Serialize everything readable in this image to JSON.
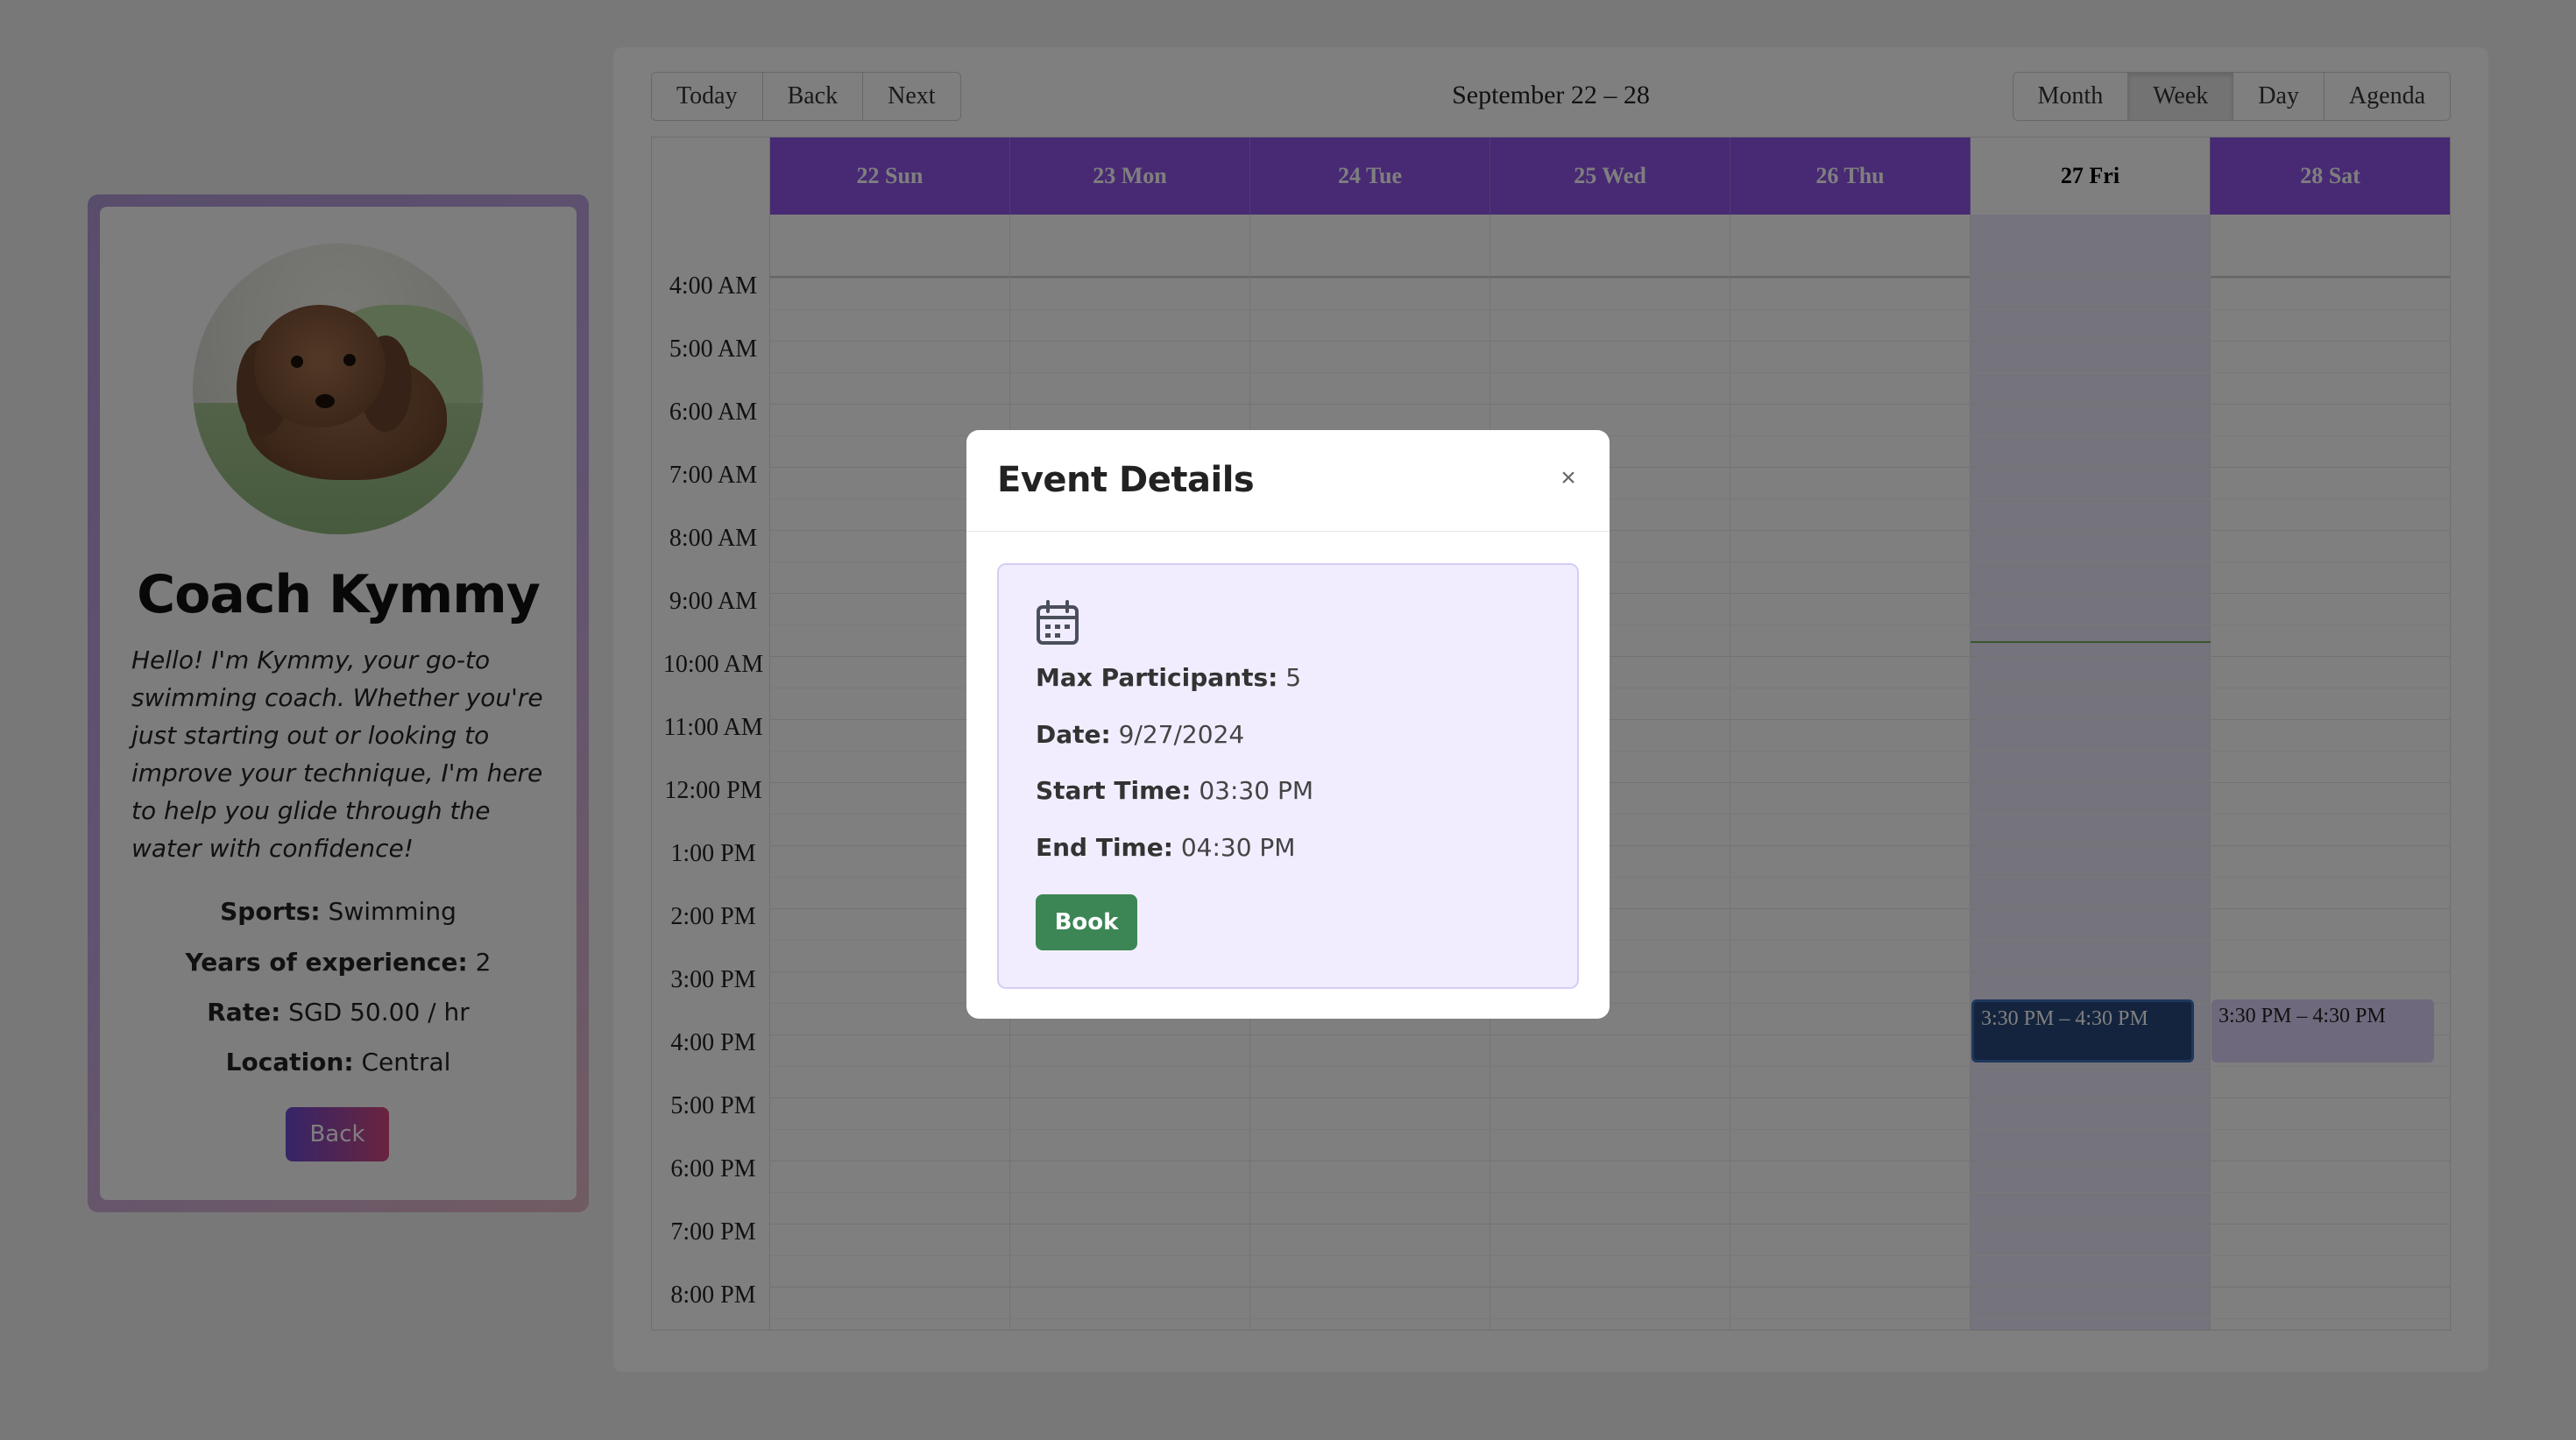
{
  "coach": {
    "name": "Coach Kymmy",
    "bio": "Hello! I'm Kymmy, your go-to swimming coach. Whether you're just starting out or looking to improve your technique, I'm here to help you glide through the water with confidence!",
    "sports_label": "Sports:",
    "sports_value": "Swimming",
    "experience_label": "Years of experience:",
    "experience_value": "2",
    "rate_label": "Rate:",
    "rate_value": "SGD 50.00 / hr",
    "location_label": "Location:",
    "location_value": "Central",
    "back_label": "Back"
  },
  "calendar": {
    "nav": {
      "today": "Today",
      "back": "Back",
      "next": "Next"
    },
    "range": "September 22 – 28",
    "views": {
      "month": "Month",
      "week": "Week",
      "day": "Day",
      "agenda": "Agenda"
    },
    "active_view": "Week",
    "days": [
      "22 Sun",
      "23 Mon",
      "24 Tue",
      "25 Wed",
      "26 Thu",
      "27 Fri",
      "28 Sat"
    ],
    "today_day": "27 Fri",
    "times": [
      "4:00 AM",
      "5:00 AM",
      "6:00 AM",
      "7:00 AM",
      "8:00 AM",
      "9:00 AM",
      "10:00 AM",
      "11:00 AM",
      "12:00 PM",
      "1:00 PM",
      "2:00 PM",
      "3:00 PM",
      "4:00 PM",
      "5:00 PM",
      "6:00 PM",
      "7:00 PM",
      "8:00 PM"
    ],
    "events": [
      {
        "day": "27 Fri",
        "label": "3:30 PM – 4:30 PM",
        "selected": true
      },
      {
        "day": "28 Sat",
        "label": "3:30 PM – 4:30 PM",
        "selected": false
      }
    ],
    "colors": {
      "header": "#8f55e6",
      "today_col": "#eae6f8",
      "event_selected": "#28497c",
      "event": "#dcd2f8"
    }
  },
  "modal": {
    "title": "Event Details",
    "close": "×",
    "icon": "calendar-icon",
    "max_participants_label": "Max Participants:",
    "max_participants_value": "5",
    "date_label": "Date:",
    "date_value": "9/27/2024",
    "start_label": "Start Time:",
    "start_value": "03:30 PM",
    "end_label": "End Time:",
    "end_value": "04:30 PM",
    "book_label": "Book",
    "book_color": "#3c8656"
  }
}
